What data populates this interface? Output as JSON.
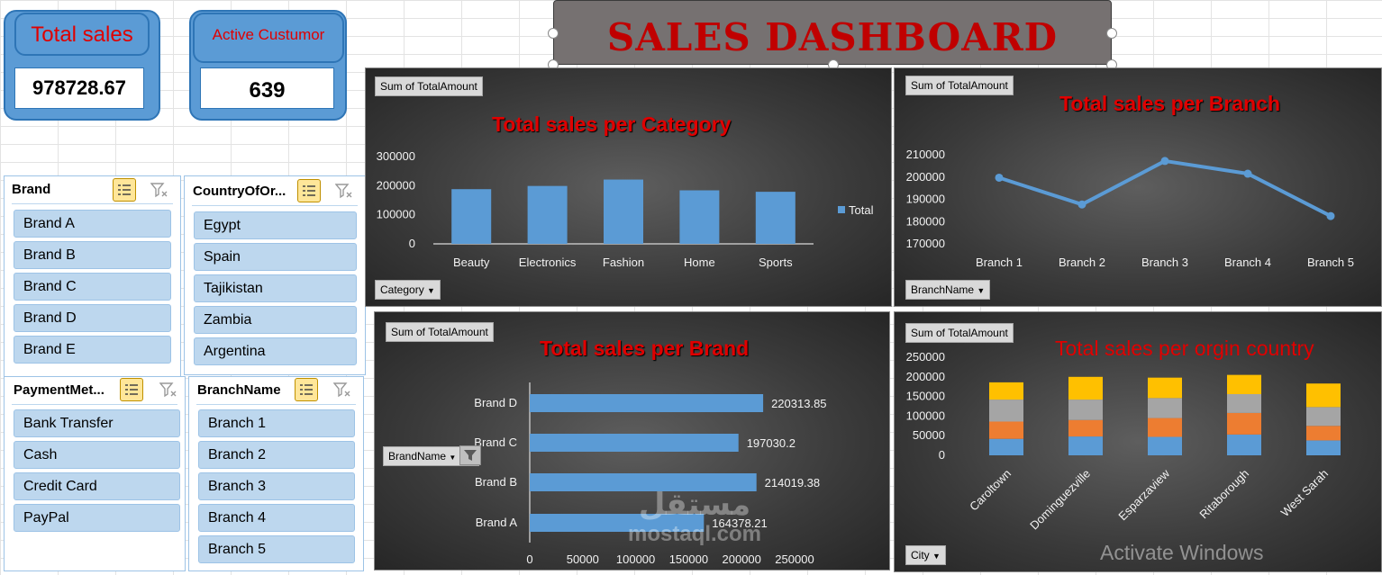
{
  "kpis": {
    "total_sales": {
      "label": "Total sales",
      "value": "978728.67"
    },
    "active_customers": {
      "label": "Active Custumor",
      "value": "639"
    }
  },
  "dashboard_title": "SALES DASHBOARD",
  "slicers": {
    "brand": {
      "header": "Brand",
      "items": [
        "Brand A",
        "Brand B",
        "Brand C",
        "Brand D",
        "Brand E"
      ]
    },
    "country": {
      "header": "CountryOfOr...",
      "items": [
        "Egypt",
        "Spain",
        "Tajikistan",
        "Zambia",
        "Argentina"
      ]
    },
    "payment": {
      "header": "PaymentMet...",
      "items": [
        "Bank Transfer",
        "Cash",
        "Credit Card",
        "PayPal"
      ]
    },
    "branch": {
      "header": "BranchName",
      "items": [
        "Branch 1",
        "Branch 2",
        "Branch 3",
        "Branch 4",
        "Branch 5"
      ]
    }
  },
  "panels": {
    "category": {
      "field_button": "Sum of TotalAmount",
      "filter_button": "Category"
    },
    "branch": {
      "field_button": "Sum of TotalAmount",
      "filter_button": "BranchName"
    },
    "brand": {
      "field_button": "Sum of TotalAmount",
      "filter_button": "BrandName"
    },
    "country": {
      "field_button": "Sum of TotalAmount",
      "filter_button": "City"
    }
  },
  "watermark": {
    "text": "Activate Windows",
    "logo_arabic": "مستقل",
    "logo_latin": "mostaql.com"
  },
  "colors": {
    "bar_blue": "#5b9bd5",
    "title_red": "#e00000",
    "panel_dark": "#3a3a3a"
  },
  "chart_data": [
    {
      "type": "bar",
      "title": "Total sales per Category",
      "categories": [
        "Beauty",
        "Electronics",
        "Fashion",
        "Home",
        "Sports"
      ],
      "series": [
        {
          "name": "Total",
          "values": [
            188000,
            199000,
            221000,
            184000,
            179000
          ]
        }
      ],
      "ylim": [
        0,
        300000
      ],
      "yticks": [
        0,
        100000,
        200000,
        300000
      ],
      "legend": "right"
    },
    {
      "type": "line",
      "title": "Total sales per Branch",
      "categories": [
        "Branch 1",
        "Branch 2",
        "Branch 3",
        "Branch 4",
        "Branch 5"
      ],
      "series": [
        {
          "values": [
            199700,
            187700,
            207200,
            201500,
            182500
          ]
        }
      ],
      "ylim": [
        170000,
        210000
      ],
      "yticks": [
        170000,
        180000,
        190000,
        200000,
        210000
      ]
    },
    {
      "type": "bar",
      "orientation": "horizontal",
      "title": "Total sales per Brand",
      "categories": [
        "Brand D",
        "Brand C",
        "Brand B",
        "Brand A"
      ],
      "values": [
        220313.85,
        197030.2,
        214019.38,
        164378.21
      ],
      "data_labels": [
        "220313.85",
        "197030.2",
        "214019.38",
        "164378.21"
      ],
      "xlim": [
        0,
        250000
      ],
      "xticks": [
        0,
        50000,
        100000,
        150000,
        200000,
        250000
      ]
    },
    {
      "type": "bar",
      "stacked": true,
      "title": "Total sales per orgin country",
      "categories": [
        "Caroltown",
        "Dominguezville",
        "Esparzaview",
        "Ritaborough",
        "West Sarah"
      ],
      "series": [
        {
          "values": [
            42000,
            48000,
            47000,
            53000,
            38000
          ],
          "color": "#5b9bd5"
        },
        {
          "values": [
            44000,
            42000,
            48000,
            55000,
            37000
          ],
          "color": "#ed7d31"
        },
        {
          "values": [
            56000,
            52000,
            51000,
            48000,
            48000
          ],
          "color": "#a5a5a5"
        },
        {
          "values": [
            44000,
            58000,
            52000,
            49000,
            60000
          ],
          "color": "#ffc000"
        }
      ],
      "ylim": [
        0,
        250000
      ],
      "yticks": [
        0,
        50000,
        100000,
        150000,
        200000,
        250000
      ]
    }
  ]
}
